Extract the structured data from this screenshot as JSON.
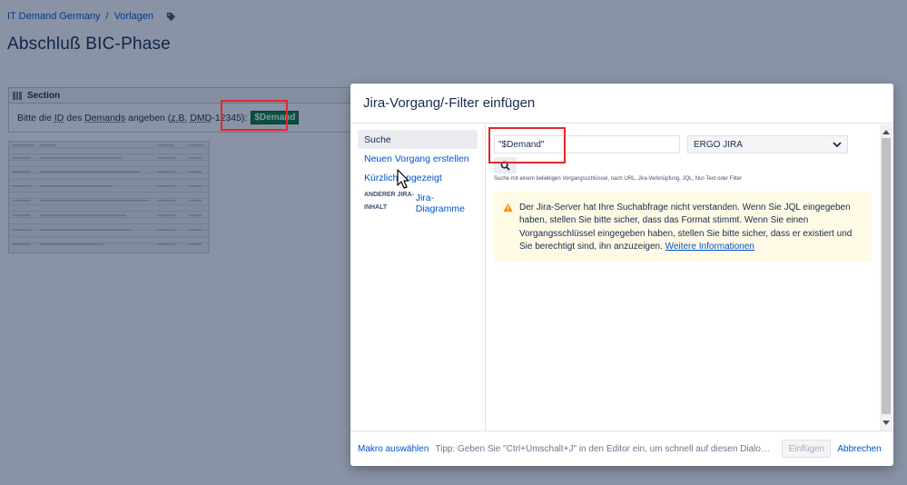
{
  "page": {
    "breadcrumb": [
      "IT Demand Germany",
      "Vorlagen"
    ],
    "breadcrumb_separator": "/",
    "title": "Abschluß BIC-Phase",
    "section": {
      "label": "Section",
      "text_parts": [
        "Bitte die ",
        "ID",
        " des ",
        "Demands",
        " angeben (",
        "z.B.",
        " ",
        "DMD",
        "-12345): "
      ],
      "variable_chip": "$Demand"
    }
  },
  "dialog": {
    "title": "Jira-Vorgang/-Filter einfügen",
    "nav": {
      "items": [
        "Suche",
        "Neuen Vorgang erstellen",
        "Kürzlich angezeigt"
      ],
      "group_label": "Anderer Jira-Inhalt",
      "group_item": "Jira-Diagramme"
    },
    "search": {
      "value": "\"$Demand\"",
      "server": "ERGO JIRA",
      "hint": "Suche mit einem beliebigen Vorgangsschlüssel, nach URL, Jira-Verknüpfung, JQL, Nur-Text oder Filter"
    },
    "warning": {
      "message": "Der Jira-Server hat Ihre Suchabfrage nicht verstanden. Wenn Sie JQL eingegeben haben, stellen Sie bitte sicher, dass das Format stimmt. Wenn Sie einen Vorgangsschlüssel eingegeben haben, stellen Sie bitte sicher, dass er existiert und Sie berechtigt sind, ihn anzuzeigen.",
      "link": "Weitere Informationen"
    },
    "footer": {
      "macro_link": "Makro auswählen",
      "tip": "Tipp: Geben Sie \"Ctrl+Umschalt+J\" in den Editor ein, um schnell auf diesen Dialog zugreifen zu können.",
      "insert_label": "Einfügen",
      "cancel_label": "Abbrechen"
    }
  },
  "colors": {
    "link": "#0052cc",
    "highlight": "#e5262e",
    "warning_bg": "#fffae6",
    "warning_icon": "#ff8b00",
    "chip": "#0f7f3b"
  }
}
